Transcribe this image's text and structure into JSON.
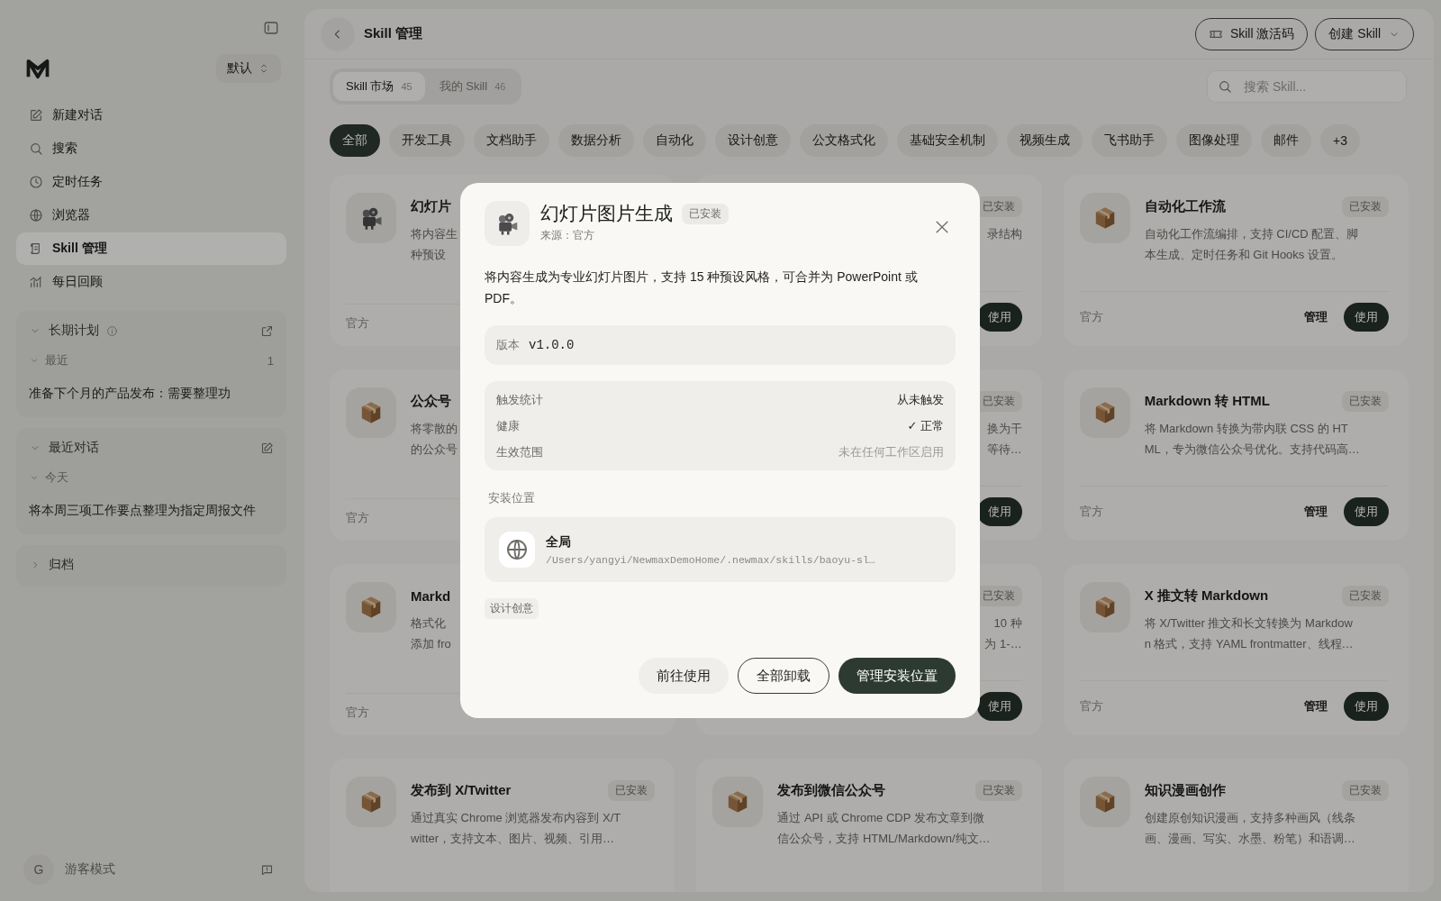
{
  "sidebar": {
    "mode_selector": {
      "label": "默认"
    },
    "nav_items": [
      {
        "label": "新建对话",
        "selected": false
      },
      {
        "label": "搜索",
        "selected": false
      },
      {
        "label": "定时任务",
        "selected": false
      },
      {
        "label": "浏览器",
        "selected": false
      },
      {
        "label": "Skill 管理",
        "selected": true
      },
      {
        "label": "每日回顾",
        "selected": false
      }
    ],
    "sections": [
      {
        "title": "长期计划",
        "expanded": true,
        "groups": [
          {
            "title": "最近",
            "count": "1",
            "expanded": true,
            "items": [
              "准备下个月的产品发布：需要整理功"
            ]
          }
        ]
      },
      {
        "title": "最近对话",
        "expanded": true,
        "groups": [
          {
            "title": "今天",
            "expanded": true,
            "items": [
              "将本周三项工作要点整理为指定周报文件"
            ]
          }
        ]
      },
      {
        "title": "归档",
        "expanded": false
      }
    ],
    "user": {
      "avatar": "G",
      "label": "游客模式"
    }
  },
  "header": {
    "title": "Skill 管理",
    "buttons": [
      {
        "label": "Skill 激活码",
        "kind": "code"
      },
      {
        "label": "创建 Skill",
        "kind": "dropdown"
      }
    ]
  },
  "tabs": [
    {
      "label": "Skill 市场",
      "count": "45",
      "selected": true
    },
    {
      "label": "我的 Skill",
      "count": "46",
      "selected": false
    }
  ],
  "search": {
    "placeholder": "搜索 Skill..."
  },
  "categories": [
    {
      "label": "全部",
      "selected": true
    },
    {
      "label": "开发工具",
      "selected": false
    },
    {
      "label": "文档助手",
      "selected": false
    },
    {
      "label": "数据分析",
      "selected": false
    },
    {
      "label": "自动化",
      "selected": false
    },
    {
      "label": "设计创意",
      "selected": false
    },
    {
      "label": "公文格式化",
      "selected": false
    },
    {
      "label": "基础安全机制",
      "selected": false
    },
    {
      "label": "视频生成",
      "selected": false
    },
    {
      "label": "飞书助手",
      "selected": false
    },
    {
      "label": "图像处理",
      "selected": false
    },
    {
      "label": "邮件",
      "selected": false
    },
    {
      "label": "+3",
      "selected": false
    }
  ],
  "cards": [
    {
      "kind": "left_part",
      "title": "幻灯片",
      "desc_lines": [
        "将内容生",
        "种预设"
      ],
      "source": "官方"
    },
    {
      "kind": "right_part",
      "badge": "已安装",
      "desc_lines": [
        "录结构"
      ],
      "buttons": [
        "使用"
      ]
    },
    {
      "kind": "full",
      "title": "自动化工作流",
      "badge": "已安装",
      "desc_lines": [
        "自动化工作流编排，支持 CI/CD 配置、脚",
        "本生成、定时任务和 Git Hooks 设置。"
      ],
      "source": "官方",
      "buttons": [
        "管理",
        "使用"
      ]
    },
    {
      "kind": "left_part",
      "title": "公众号",
      "desc_lines": [
        "将零散的",
        "的公众号"
      ],
      "source": "官方"
    },
    {
      "kind": "right_part",
      "badge": "已安装",
      "desc_lines": [
        "换为干",
        "等待…"
      ],
      "buttons": [
        "使用"
      ]
    },
    {
      "kind": "full",
      "title": "Markdown 转 HTML",
      "badge": "已安装",
      "desc_lines": [
        "将 Markdown 转换为带内联 CSS 的 HT",
        "ML，专为微信公众号优化。支持代码高…"
      ],
      "source": "官方",
      "buttons": [
        "管理",
        "使用"
      ]
    },
    {
      "kind": "left_part",
      "title": "Markd",
      "desc_lines": [
        "格式化",
        "添加 fro"
      ],
      "source": "官方"
    },
    {
      "kind": "right_part",
      "badge": "已安装",
      "desc_lines": [
        "10 种",
        "为 1-…"
      ],
      "buttons": [
        "使用"
      ]
    },
    {
      "kind": "full",
      "title": "X 推文转 Markdown",
      "badge": "已安装",
      "desc_lines": [
        "将 X/Twitter 推文和长文转换为 Markdow",
        "n 格式，支持 YAML frontmatter、线程…"
      ],
      "source": "官方",
      "buttons": [
        "管理",
        "使用"
      ]
    },
    {
      "kind": "full",
      "title": "发布到 X/Twitter",
      "badge": "已安装",
      "desc_lines": [
        "通过真实 Chrome 浏览器发布内容到 X/T",
        "witter，支持文本、图片、视频、引用…"
      ]
    },
    {
      "kind": "full",
      "title": "发布到微信公众号",
      "badge": "已安装",
      "desc_lines": [
        "通过 API 或 Chrome CDP 发布文章到微",
        "信公众号，支持 HTML/Markdown/纯文…"
      ]
    },
    {
      "kind": "full",
      "title": "知识漫画创作",
      "badge": "已安装",
      "desc_lines": [
        "创建原创知识漫画，支持多种画风（线条",
        "画、漫画、写实、水墨、粉笔）和语调…"
      ]
    }
  ],
  "dialog": {
    "title": "幻灯片图片生成",
    "badge": "已安装",
    "source": "来源：官方",
    "description": "将内容生成为专业幻灯片图片，支持 15 种预设风格，可合并为 PowerPoint 或 PDF。",
    "version": {
      "label": "版本",
      "value": "v1.0.0"
    },
    "stats": [
      {
        "label": "触发统计",
        "value": "从未触发",
        "muted": false
      },
      {
        "label": "健康",
        "value": "✓ 正常",
        "muted": false
      },
      {
        "label": "生效范围",
        "value": "未在任何工作区启用",
        "muted": true
      }
    ],
    "location_title": "安装位置",
    "location": {
      "name": "全局",
      "path": "/Users/yangyi/NewmaxDemoHome/.newmax/skills/baoyu-sl…"
    },
    "tags": [
      "设计创意"
    ],
    "buttons": [
      {
        "label": "前往使用",
        "kind": "secondary"
      },
      {
        "label": "全部卸载",
        "kind": "outline"
      },
      {
        "label": "管理安装位置",
        "kind": "primary"
      }
    ]
  }
}
